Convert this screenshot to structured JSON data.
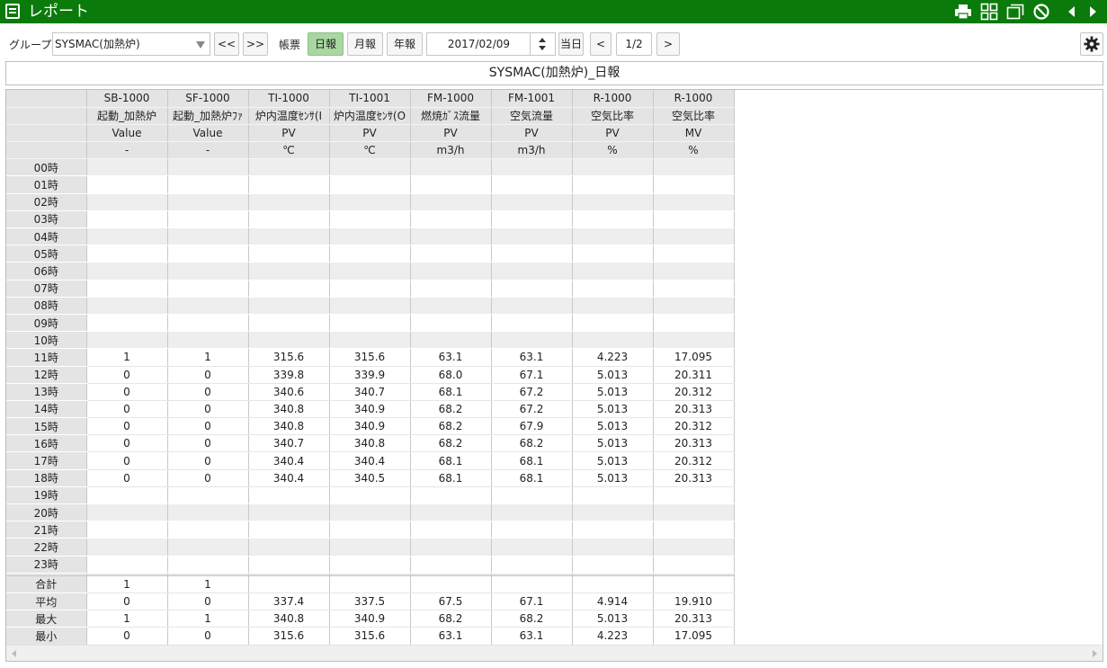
{
  "app": {
    "title": "レポート"
  },
  "toolbar": {
    "group_label": "グループ",
    "group_value": "SYSMAC(加熱炉)",
    "prev_group": "<<",
    "next_group": ">>",
    "form_label": "帳票",
    "daily": "日報",
    "monthly": "月報",
    "yearly": "年報",
    "date": "2017/02/09",
    "today": "当日",
    "prev_page": "<",
    "page": "1/2",
    "next_page": ">"
  },
  "report": {
    "title": "SYSMAC(加熱炉)_日報",
    "columns": [
      {
        "tag": "SB-1000",
        "name": "起動_加熱炉",
        "type": "Value",
        "unit": "-"
      },
      {
        "tag": "SF-1000",
        "name": "起動_加熱炉ﾌｧ",
        "type": "Value",
        "unit": "-"
      },
      {
        "tag": "TI-1000",
        "name": "炉内温度ｾﾝｻ(I",
        "type": "PV",
        "unit": "℃"
      },
      {
        "tag": "TI-1001",
        "name": "炉内温度ｾﾝｻ(O",
        "type": "PV",
        "unit": "℃"
      },
      {
        "tag": "FM-1000",
        "name": "燃焼ｶﾞｽ流量",
        "type": "PV",
        "unit": "m3/h"
      },
      {
        "tag": "FM-1001",
        "name": "空気流量",
        "type": "PV",
        "unit": "m3/h"
      },
      {
        "tag": "R-1000",
        "name": "空気比率",
        "type": "PV",
        "unit": "%"
      },
      {
        "tag": "R-1000",
        "name": "空気比率",
        "type": "MV",
        "unit": "%"
      }
    ],
    "rows": [
      {
        "label": "00時",
        "values": [
          "",
          "",
          "",
          "",
          "",
          "",
          "",
          ""
        ]
      },
      {
        "label": "01時",
        "values": [
          "",
          "",
          "",
          "",
          "",
          "",
          "",
          ""
        ]
      },
      {
        "label": "02時",
        "values": [
          "",
          "",
          "",
          "",
          "",
          "",
          "",
          ""
        ]
      },
      {
        "label": "03時",
        "values": [
          "",
          "",
          "",
          "",
          "",
          "",
          "",
          ""
        ]
      },
      {
        "label": "04時",
        "values": [
          "",
          "",
          "",
          "",
          "",
          "",
          "",
          ""
        ]
      },
      {
        "label": "05時",
        "values": [
          "",
          "",
          "",
          "",
          "",
          "",
          "",
          ""
        ]
      },
      {
        "label": "06時",
        "values": [
          "",
          "",
          "",
          "",
          "",
          "",
          "",
          ""
        ]
      },
      {
        "label": "07時",
        "values": [
          "",
          "",
          "",
          "",
          "",
          "",
          "",
          ""
        ]
      },
      {
        "label": "08時",
        "values": [
          "",
          "",
          "",
          "",
          "",
          "",
          "",
          ""
        ]
      },
      {
        "label": "09時",
        "values": [
          "",
          "",
          "",
          "",
          "",
          "",
          "",
          ""
        ]
      },
      {
        "label": "10時",
        "values": [
          "",
          "",
          "",
          "",
          "",
          "",
          "",
          ""
        ]
      },
      {
        "label": "11時",
        "values": [
          "1",
          "1",
          "315.6",
          "315.6",
          "63.1",
          "63.1",
          "4.223",
          "17.095"
        ]
      },
      {
        "label": "12時",
        "values": [
          "0",
          "0",
          "339.8",
          "339.9",
          "68.0",
          "67.1",
          "5.013",
          "20.311"
        ]
      },
      {
        "label": "13時",
        "values": [
          "0",
          "0",
          "340.6",
          "340.7",
          "68.1",
          "67.2",
          "5.013",
          "20.312"
        ]
      },
      {
        "label": "14時",
        "values": [
          "0",
          "0",
          "340.8",
          "340.9",
          "68.2",
          "67.2",
          "5.013",
          "20.313"
        ]
      },
      {
        "label": "15時",
        "values": [
          "0",
          "0",
          "340.8",
          "340.9",
          "68.2",
          "67.9",
          "5.013",
          "20.312"
        ]
      },
      {
        "label": "16時",
        "values": [
          "0",
          "0",
          "340.7",
          "340.8",
          "68.2",
          "68.2",
          "5.013",
          "20.313"
        ]
      },
      {
        "label": "17時",
        "values": [
          "0",
          "0",
          "340.4",
          "340.4",
          "68.1",
          "68.1",
          "5.013",
          "20.312"
        ]
      },
      {
        "label": "18時",
        "values": [
          "0",
          "0",
          "340.4",
          "340.5",
          "68.1",
          "68.1",
          "5.013",
          "20.313"
        ]
      },
      {
        "label": "19時",
        "values": [
          "",
          "",
          "",
          "",
          "",
          "",
          "",
          ""
        ]
      },
      {
        "label": "20時",
        "values": [
          "",
          "",
          "",
          "",
          "",
          "",
          "",
          ""
        ]
      },
      {
        "label": "21時",
        "values": [
          "",
          "",
          "",
          "",
          "",
          "",
          "",
          ""
        ]
      },
      {
        "label": "22時",
        "values": [
          "",
          "",
          "",
          "",
          "",
          "",
          "",
          ""
        ]
      },
      {
        "label": "23時",
        "values": [
          "",
          "",
          "",
          "",
          "",
          "",
          "",
          ""
        ]
      }
    ],
    "summary": [
      {
        "label": "合計",
        "values": [
          "1",
          "1",
          "",
          "",
          "",
          "",
          "",
          ""
        ]
      },
      {
        "label": "平均",
        "values": [
          "0",
          "0",
          "337.4",
          "337.5",
          "67.5",
          "67.1",
          "4.914",
          "19.910"
        ]
      },
      {
        "label": "最大",
        "values": [
          "1",
          "1",
          "340.8",
          "340.9",
          "68.2",
          "68.2",
          "5.013",
          "20.313"
        ]
      },
      {
        "label": "最小",
        "values": [
          "0",
          "0",
          "315.6",
          "315.6",
          "63.1",
          "63.1",
          "4.223",
          "17.095"
        ]
      }
    ]
  },
  "icons": {
    "menu": "menu-icon",
    "print": "print-icon",
    "grid": "grid-icon",
    "window": "window-icon",
    "cancel": "cancel-icon",
    "prev": "triangle-left-icon",
    "next": "triangle-right-icon",
    "settings": "gear-icon"
  },
  "colors": {
    "titlebar": "#0a7a0a",
    "active_button": "#a8d7a0"
  }
}
